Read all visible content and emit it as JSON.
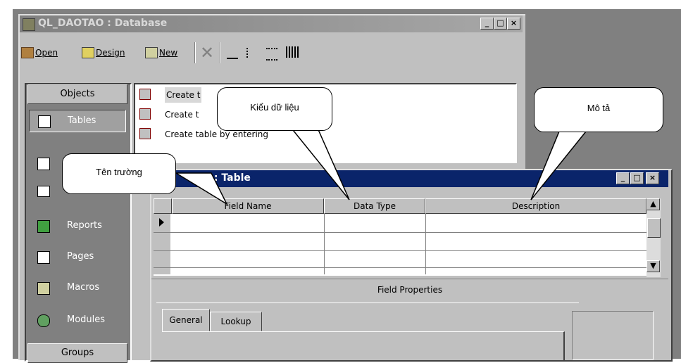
{
  "db_window": {
    "title": "QL_DAOTAO : Database",
    "controls": {
      "minimize": "_",
      "maximize": "□",
      "close": "×"
    }
  },
  "toolbar": {
    "open": "Open",
    "design": "Design",
    "new": "New"
  },
  "objects_bar": {
    "header": "Objects",
    "items": [
      "Tables",
      "Reports",
      "Pages",
      "Macros",
      "Modules"
    ],
    "groups_label": "Groups"
  },
  "object_list": {
    "items": [
      "Create t",
      "Create t",
      "Create table by entering"
    ]
  },
  "table_window": {
    "title": "ble1 : Table",
    "columns": [
      "Field Name",
      "Data Type",
      "Description"
    ],
    "field_properties_label": "Field Properties",
    "tabs": [
      "General",
      "Lookup"
    ]
  },
  "callouts": {
    "field_name": "Tên trường",
    "data_type": "Kiểu dữ liệu",
    "description": "Mô tả"
  }
}
